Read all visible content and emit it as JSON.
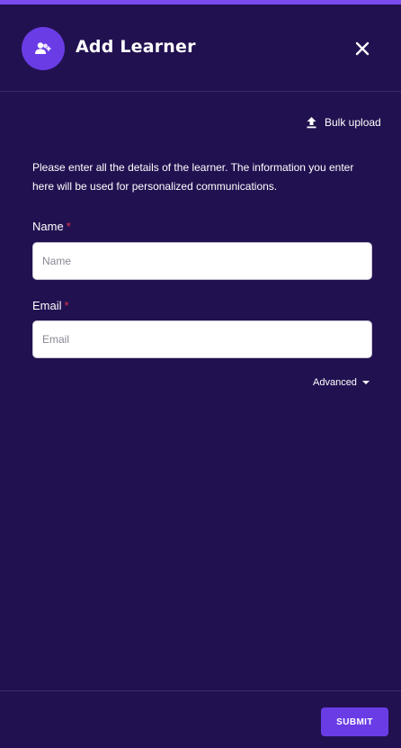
{
  "colors": {
    "background": "#221150",
    "accent": "#7a4cf0",
    "primary_button": "#6a3ce6",
    "required_marker": "#e2334f"
  },
  "header": {
    "title": "Add Learner",
    "avatar_icon": "add-user-icon",
    "close_icon": "close-icon"
  },
  "bulk_upload": {
    "label": "Bulk upload",
    "icon": "upload-icon"
  },
  "description": "Please enter all the details of the learner. The information you enter here will be used for personalized communications.",
  "form": {
    "name": {
      "label": "Name",
      "required_marker": "*",
      "placeholder": "Name",
      "value": ""
    },
    "email": {
      "label": "Email",
      "required_marker": "*",
      "placeholder": "Email",
      "value": ""
    },
    "advanced": {
      "label": "Advanced",
      "icon": "caret-down-icon"
    }
  },
  "footer": {
    "submit_label": "SUBMIT"
  }
}
